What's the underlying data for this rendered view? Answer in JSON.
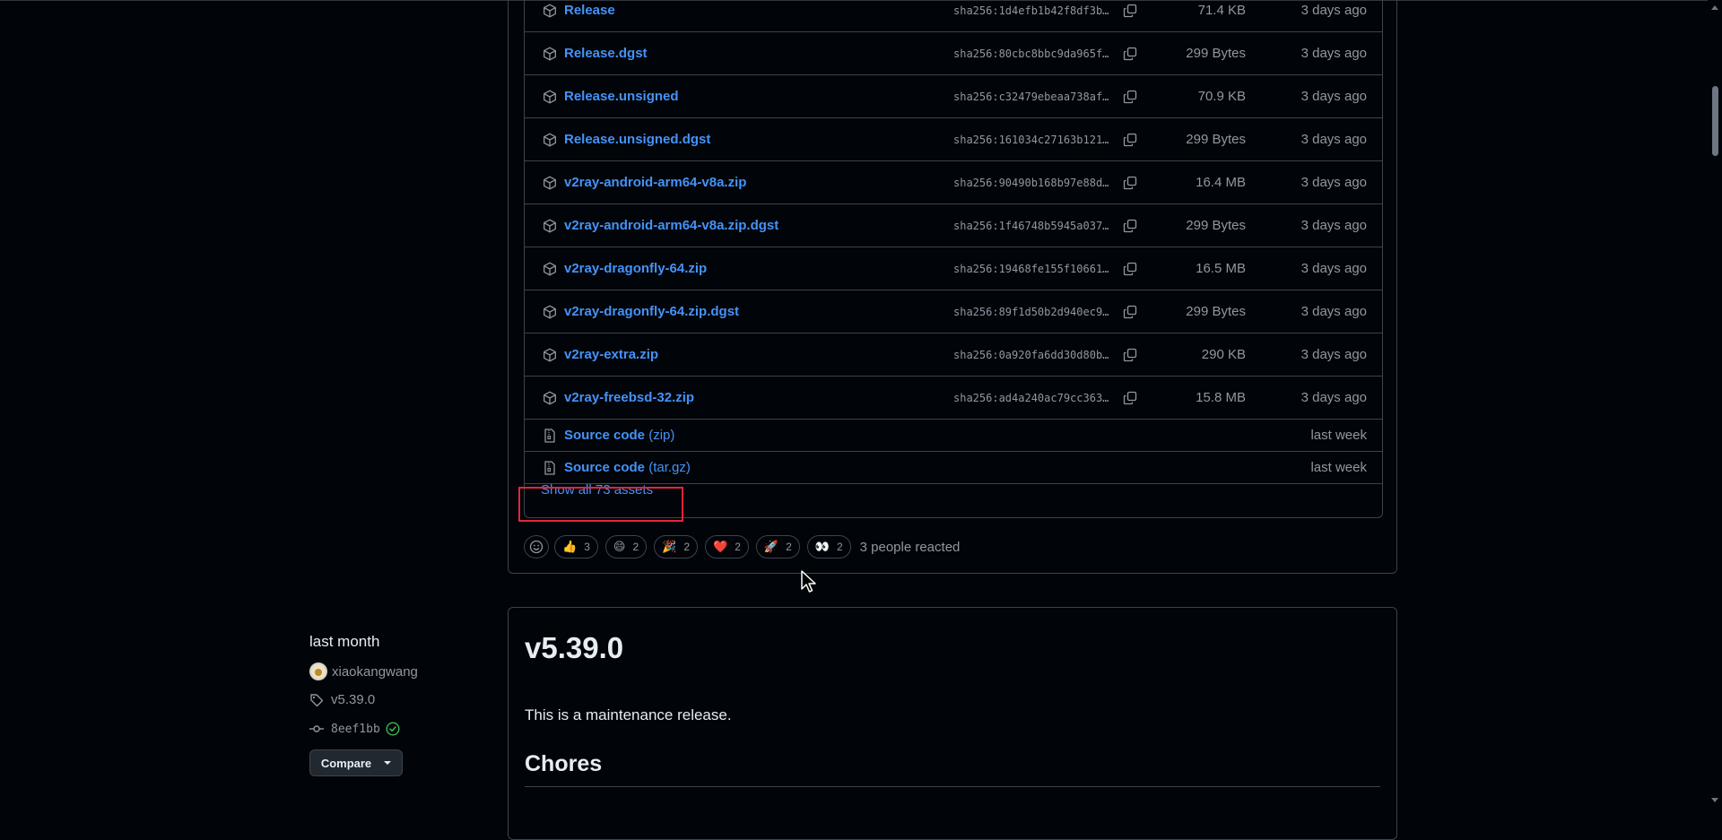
{
  "assets": {
    "rows": [
      {
        "name": "Release",
        "sha": "sha256:1d4efb1b42f8df3bf…",
        "size": "71.4 KB",
        "date": "3 days ago"
      },
      {
        "name": "Release.dgst",
        "sha": "sha256:80cbc8bbc9da965fd…",
        "size": "299 Bytes",
        "date": "3 days ago"
      },
      {
        "name": "Release.unsigned",
        "sha": "sha256:c32479ebeaa738afc…",
        "size": "70.9 KB",
        "date": "3 days ago"
      },
      {
        "name": "Release.unsigned.dgst",
        "sha": "sha256:161034c27163b1213…",
        "size": "299 Bytes",
        "date": "3 days ago"
      },
      {
        "name": "v2ray-android-arm64-v8a.zip",
        "sha": "sha256:90490b168b97e88d8…",
        "size": "16.4 MB",
        "date": "3 days ago"
      },
      {
        "name": "v2ray-android-arm64-v8a.zip.dgst",
        "sha": "sha256:1f46748b5945a0379…",
        "size": "299 Bytes",
        "date": "3 days ago"
      },
      {
        "name": "v2ray-dragonfly-64.zip",
        "sha": "sha256:19468fe155f106619…",
        "size": "16.5 MB",
        "date": "3 days ago"
      },
      {
        "name": "v2ray-dragonfly-64.zip.dgst",
        "sha": "sha256:89f1d50b2d940ec9e…",
        "size": "299 Bytes",
        "date": "3 days ago"
      },
      {
        "name": "v2ray-extra.zip",
        "sha": "sha256:0a920fa6dd30d80bc…",
        "size": "290 KB",
        "date": "3 days ago"
      },
      {
        "name": "v2ray-freebsd-32.zip",
        "sha": "sha256:ad4a240ac79cc363a…",
        "size": "15.8 MB",
        "date": "3 days ago"
      }
    ],
    "source": [
      {
        "name": "Source code",
        "ext": "(zip)",
        "date": "last week"
      },
      {
        "name": "Source code",
        "ext": "(tar.gz)",
        "date": "last week"
      }
    ],
    "show_all_label": "Show all 73 assets"
  },
  "reactions": {
    "items": [
      {
        "emoji": "👍",
        "icon": "thumbs-up",
        "count": "3"
      },
      {
        "emoji": "😄",
        "icon": "laugh",
        "count": "2"
      },
      {
        "emoji": "🎉",
        "icon": "hooray",
        "count": "2"
      },
      {
        "emoji": "❤️",
        "icon": "heart",
        "count": "2"
      },
      {
        "emoji": "🚀",
        "icon": "rocket",
        "count": "2"
      },
      {
        "emoji": "👀",
        "icon": "eyes",
        "count": "2"
      }
    ],
    "summary": "3 people reacted"
  },
  "release2": {
    "date": "last month",
    "author": "xiaokangwang",
    "tag": "v5.39.0",
    "commit": "8eef1bb",
    "compare_label": "Compare",
    "title": "v5.39.0",
    "description": "This is a maintenance release.",
    "section_heading": "Chores"
  },
  "colors": {
    "background": "#010409",
    "link": "#4493f8",
    "border": "#3d444d",
    "muted": "#9198a1",
    "highlight": "#e5243b",
    "verified": "#3fb950"
  }
}
